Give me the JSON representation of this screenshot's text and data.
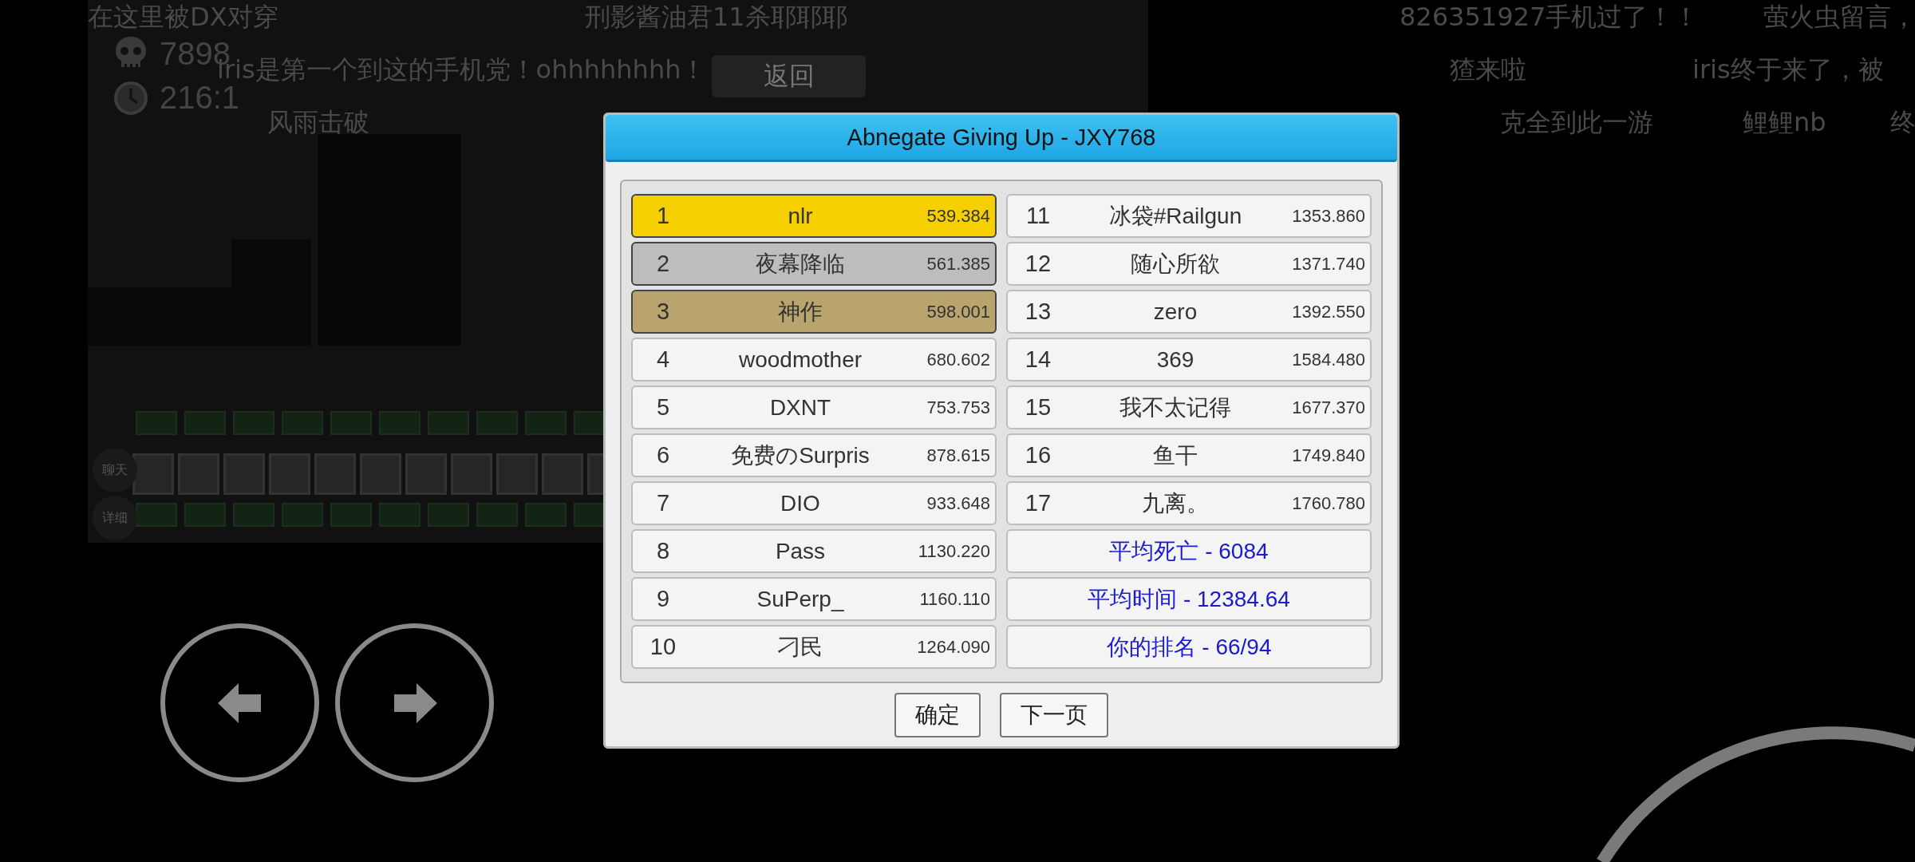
{
  "hud": {
    "deaths": "7898",
    "time": "216:1"
  },
  "back_button": "返回",
  "comment_rows": [
    [
      "在这里被DX对穿",
      "刑影酱油君11杀耶耶耶",
      "826351927手机过了！！",
      "萤火虫留言，"
    ],
    [
      "iris是第一个到这的手机党！ohhhhhhhh！",
      "猹来啦",
      "iris终于来了，被"
    ],
    [
      "风雨击破",
      "克全到此一游",
      "鲤鲤nb",
      "终"
    ]
  ],
  "side_buttons": [
    "聊天",
    "详细"
  ],
  "dialog": {
    "title": "Abnegate Giving Up - JXY768",
    "rankings": [
      {
        "rank": "1",
        "name": "nlr",
        "time": "539.384",
        "kind": "gold"
      },
      {
        "rank": "2",
        "name": "夜幕降临",
        "time": "561.385",
        "kind": "silver"
      },
      {
        "rank": "3",
        "name": "神作",
        "time": "598.001",
        "kind": "bronze"
      },
      {
        "rank": "4",
        "name": "woodmother",
        "time": "680.602",
        "kind": "plain"
      },
      {
        "rank": "5",
        "name": "DXNT",
        "time": "753.753",
        "kind": "plain"
      },
      {
        "rank": "6",
        "name": "免费のSurpris",
        "time": "878.615",
        "kind": "plain"
      },
      {
        "rank": "7",
        "name": "DIO",
        "time": "933.648",
        "kind": "plain"
      },
      {
        "rank": "8",
        "name": "Pass",
        "time": "1130.220",
        "kind": "plain"
      },
      {
        "rank": "9",
        "name": "SuPerp_",
        "time": "1160.110",
        "kind": "plain"
      },
      {
        "rank": "10",
        "name": "刁民",
        "time": "1264.090",
        "kind": "plain"
      },
      {
        "rank": "11",
        "name": "冰袋#Railgun",
        "time": "1353.860",
        "kind": "plain"
      },
      {
        "rank": "12",
        "name": "随心所欲",
        "time": "1371.740",
        "kind": "plain"
      },
      {
        "rank": "13",
        "name": "zero",
        "time": "1392.550",
        "kind": "plain"
      },
      {
        "rank": "14",
        "name": "369",
        "time": "1584.480",
        "kind": "plain"
      },
      {
        "rank": "15",
        "name": "我不太记得",
        "time": "1677.370",
        "kind": "plain"
      },
      {
        "rank": "16",
        "name": "鱼干",
        "time": "1749.840",
        "kind": "plain"
      },
      {
        "rank": "17",
        "name": "九离。",
        "time": "1760.780",
        "kind": "plain"
      }
    ],
    "stats": [
      "平均死亡 - 6084",
      "平均时间 - 12384.64",
      "你的排名 - 66/94"
    ],
    "buttons": [
      "确定",
      "下一页"
    ]
  }
}
